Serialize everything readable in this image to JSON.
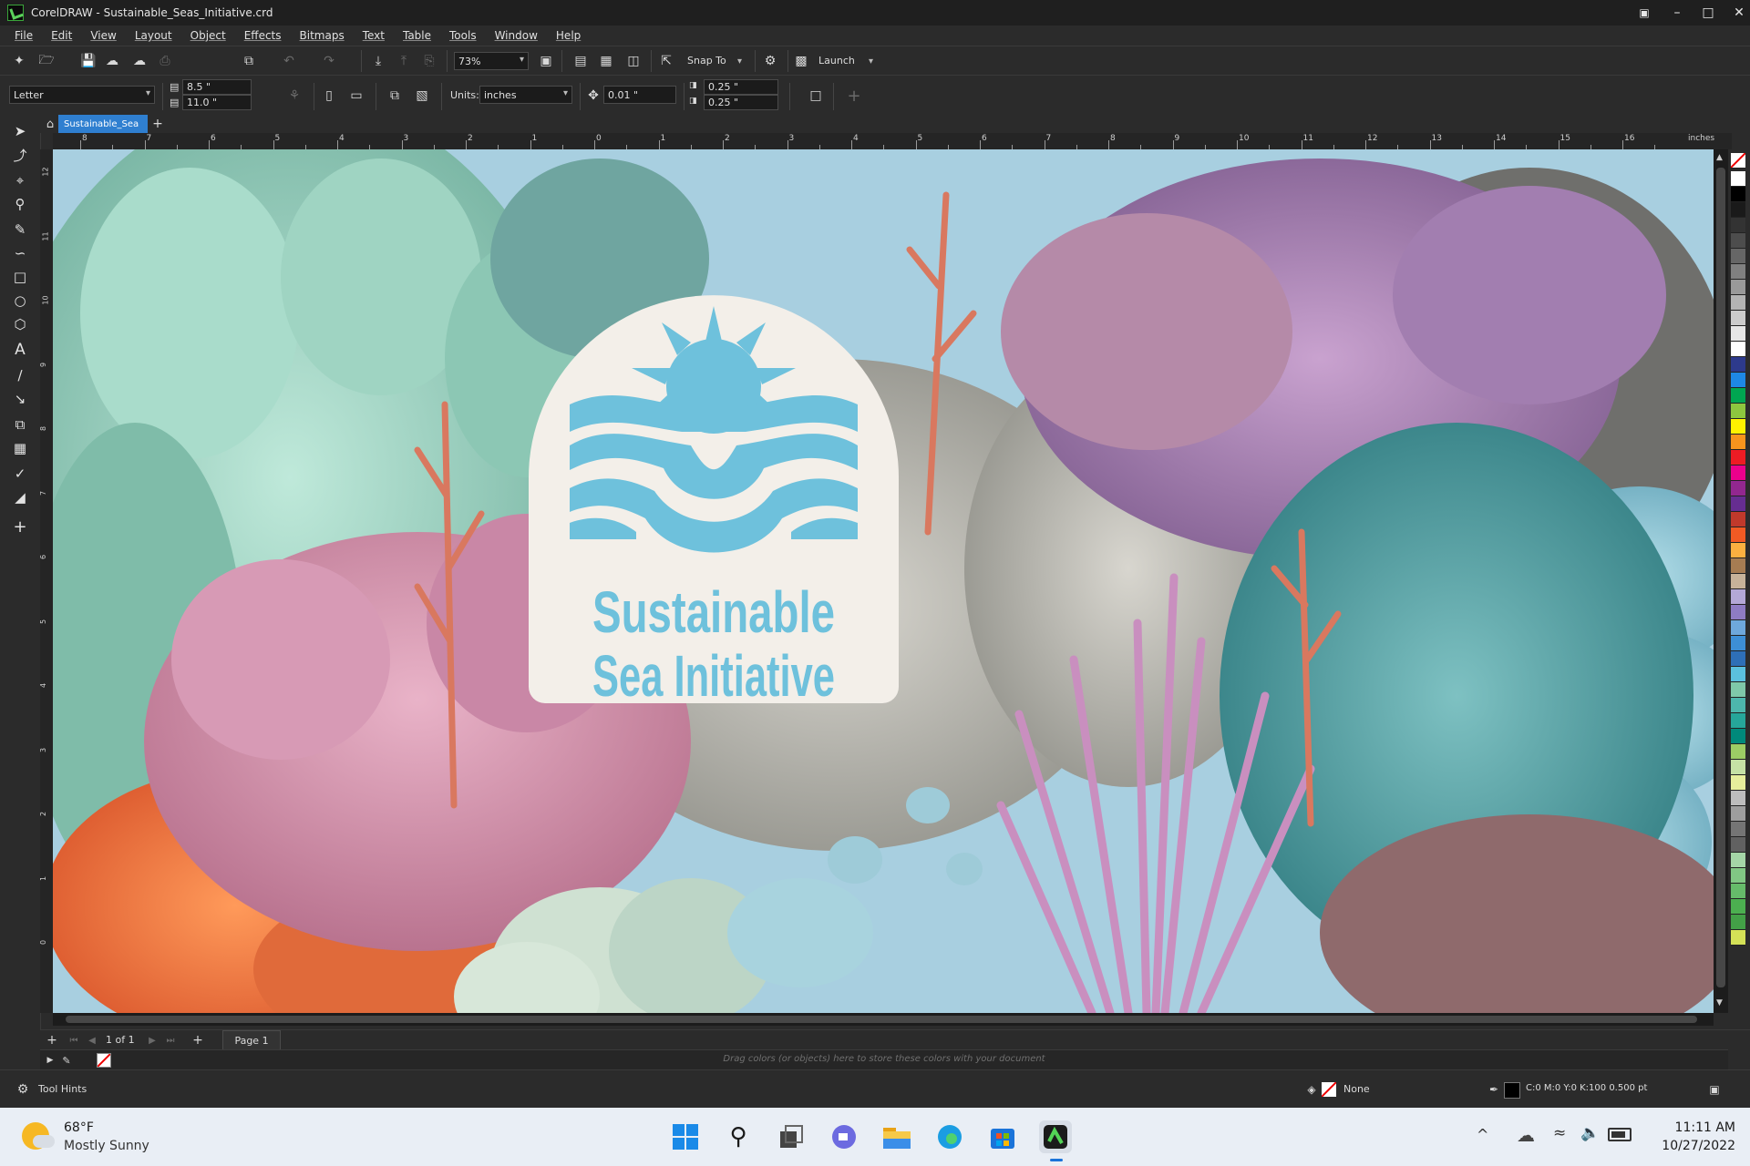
{
  "window": {
    "app_name": "CorelDRAW",
    "title": "CorelDRAW - Sustainable_Seas_Initiative.crd"
  },
  "menu": [
    "File",
    "Edit",
    "View",
    "Layout",
    "Object",
    "Effects",
    "Bitmaps",
    "Text",
    "Table",
    "Tools",
    "Window",
    "Help"
  ],
  "standard_toolbar": {
    "zoom": "73%",
    "snap_to": "Snap To",
    "launch": "Launch"
  },
  "property_bar": {
    "page_size": "Letter",
    "width": "8.5 \"",
    "height": "11.0 \"",
    "units_label": "Units:",
    "units": "inches",
    "nudge": "0.01 \"",
    "dup_x": "0.25 \"",
    "dup_y": "0.25 \""
  },
  "document_tab": "Sustainable_Sea",
  "ruler": {
    "unit_label": "inches",
    "h_numbers": [
      "8",
      "7",
      "6",
      "5",
      "4",
      "3",
      "2",
      "1",
      "0",
      "1",
      "2",
      "3",
      "4",
      "5",
      "6",
      "7",
      "8",
      "9",
      "10",
      "11",
      "12",
      "13",
      "14",
      "15",
      "16"
    ],
    "v_numbers": [
      "12",
      "11",
      "10",
      "9",
      "8",
      "7",
      "6",
      "5",
      "4",
      "3",
      "2",
      "1",
      "0"
    ]
  },
  "artwork": {
    "logo_line1": "Sustainable",
    "logo_line2": "Sea Initiative",
    "logo_color": "#6ec1dc",
    "badge_color": "#f3efe9"
  },
  "pages": {
    "counter": "1 of 1",
    "page_tab": "Page 1"
  },
  "document_palette_hint": "Drag colors (or objects) here to store these colors with your document",
  "status": {
    "tool_hints": "Tool Hints",
    "fill": "None",
    "outline": "C:0 M:0 Y:0 K:100  0.500 pt"
  },
  "taskbar": {
    "weather_temp": "68°F",
    "weather_desc": "Mostly Sunny",
    "time": "11:11 AM",
    "date": "10/27/2022"
  },
  "palette_colors": [
    "#ffffff",
    "#000000",
    "#1a1a1a",
    "#333333",
    "#4d4d4d",
    "#666666",
    "#808080",
    "#999999",
    "#b3b3b3",
    "#cccccc",
    "#e6e6e6",
    "#ffffff",
    "#2d3a8c",
    "#1e88e5",
    "#00a651",
    "#8dc63f",
    "#fff200",
    "#f7941d",
    "#ed1c24",
    "#ec008c",
    "#92278f",
    "#662d91",
    "#c0392b",
    "#f15a24",
    "#fbb040",
    "#a67c52",
    "#c7b299",
    "#b3a8d6",
    "#8e7cc3",
    "#6ea8dc",
    "#3d8fd6",
    "#2e6fb7",
    "#5bc0de",
    "#7fc8a9",
    "#4db6ac",
    "#26a69a",
    "#00897b",
    "#9ccc65",
    "#c5e1a5",
    "#e6ee9c",
    "#bdbdbd",
    "#9e9e9e",
    "#757575",
    "#616161",
    "#a5d6a7",
    "#81c784",
    "#66bb6a",
    "#4caf50",
    "#43a047",
    "#d4e157"
  ]
}
